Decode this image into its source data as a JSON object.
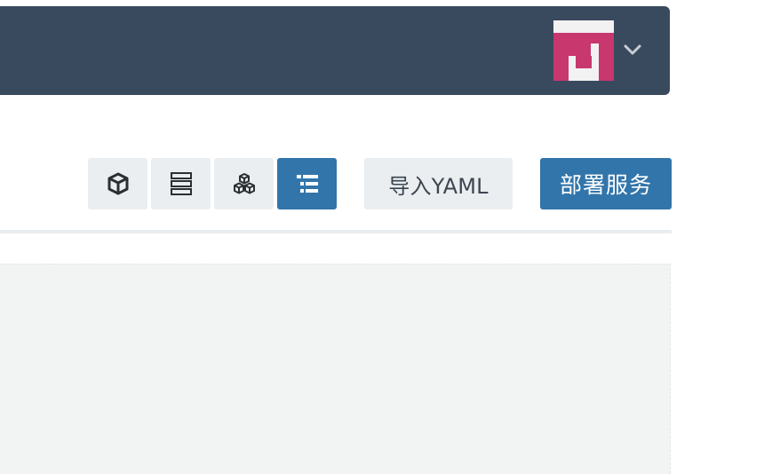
{
  "header": {
    "user_menu_icon": "chevron-down-icon",
    "avatar": {
      "colors": {
        "primary": "#c8376e",
        "background": "#f2f2f2"
      }
    }
  },
  "toolbar": {
    "view_buttons": [
      {
        "icon": "cube-icon",
        "active": false
      },
      {
        "icon": "server-icon",
        "active": false
      },
      {
        "icon": "cubes-icon",
        "active": false
      },
      {
        "icon": "list-icon",
        "active": true
      }
    ],
    "import_label": "导入YAML",
    "deploy_label": "部署服务"
  },
  "colors": {
    "header_bg": "#3a4a5e",
    "accent": "#3275aa",
    "button_bg": "#eaeef0",
    "content_bg": "#f2f3f3"
  }
}
